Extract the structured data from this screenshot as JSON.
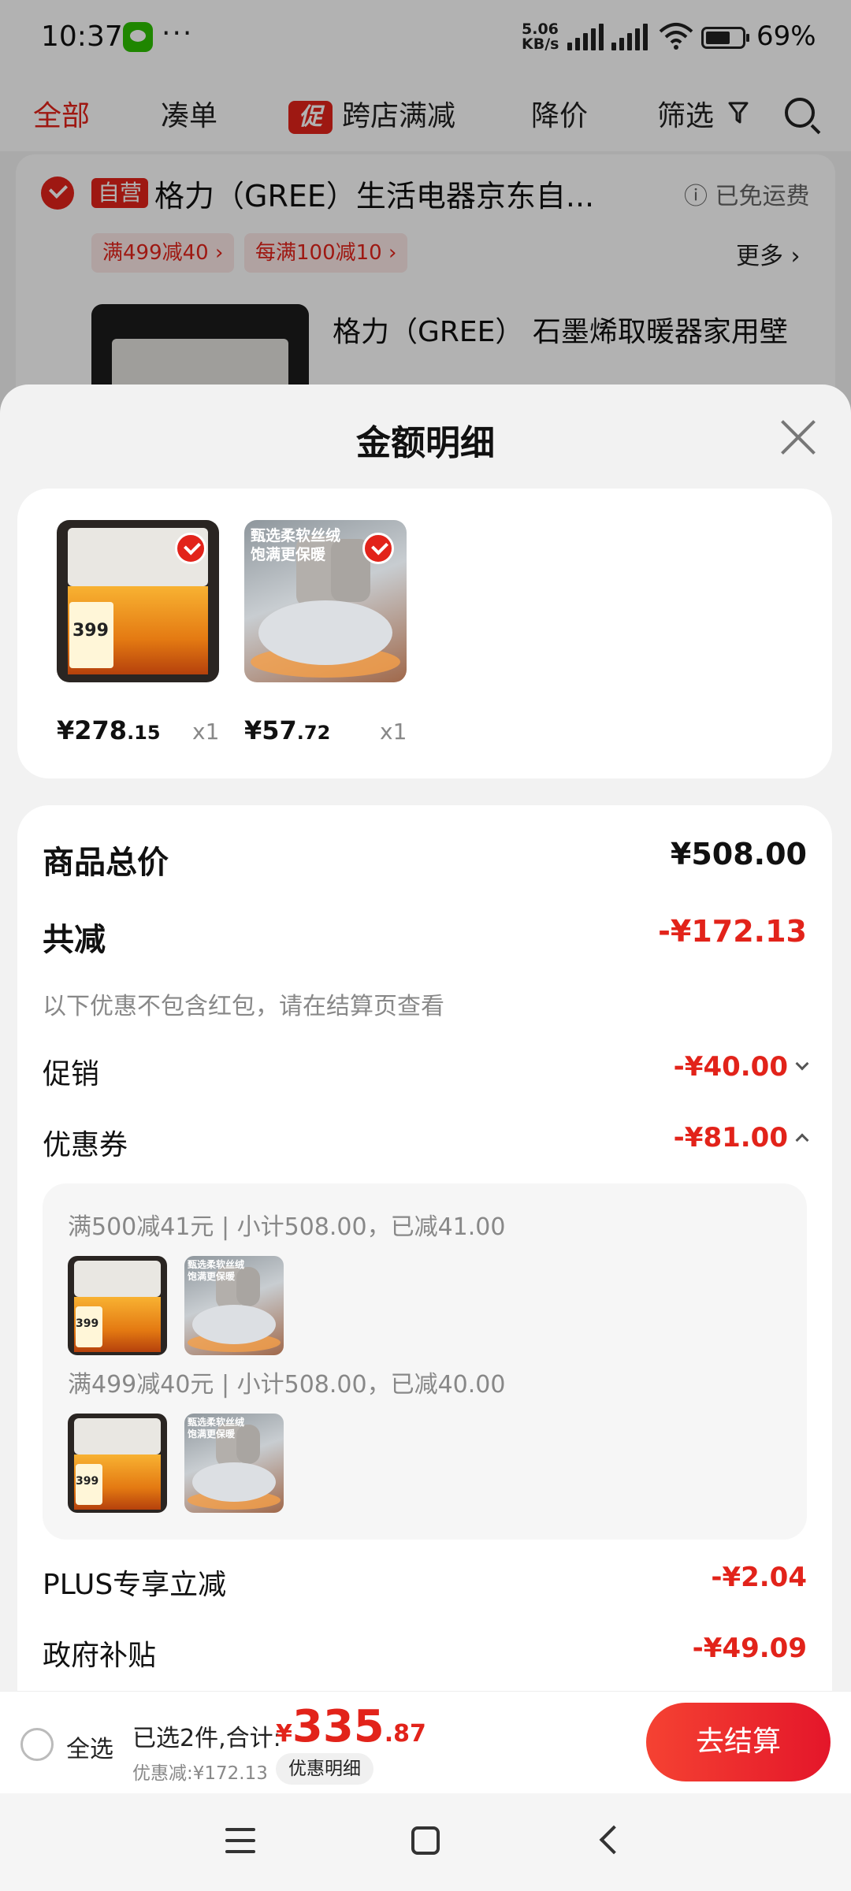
{
  "status_bar": {
    "time": "10:37",
    "dots": "···",
    "net_speed_line1": "5.06",
    "net_speed_line2": "KB/s",
    "battery": "69%"
  },
  "filter_bar": {
    "all": "全部",
    "bundle": "凑单",
    "promo_tag": "促",
    "cross_store": "跨店满减",
    "price_drop": "降价",
    "filter": "筛选"
  },
  "shop": {
    "self_tag": "自营",
    "name": "格力（GREE）生活电器京东自...",
    "free_shipping": "已免运费",
    "coupons": [
      "满499减40 ›",
      "每满100减10 ›"
    ],
    "more": "更多 ›",
    "product_title": "格力（GREE） 石墨烯取暖器家用壁"
  },
  "sheet": {
    "title": "金额明细",
    "items": [
      {
        "price_int": "¥278",
        "price_dec": ".15",
        "qty": "x1",
        "image": "heater",
        "badge": "399"
      },
      {
        "price_int": "¥57",
        "price_dec": ".72",
        "qty": "x1",
        "image": "slipper",
        "promo_text": "甄选柔软丝绒 饱满更保暖"
      }
    ],
    "goods_total_label": "商品总价",
    "goods_total_value": "¥508.00",
    "total_reduce_label": "共减",
    "total_reduce_value": "-¥172.13",
    "note": "以下优惠不包含红包，请在结算页查看",
    "promo_label": "促销",
    "promo_value": "-¥40.00",
    "coupon_label": "优惠券",
    "coupon_value": "-¥81.00",
    "coupon_rules": [
      "满500减41元 | 小计508.00，已减41.00",
      "满499减40元 | 小计508.00，已减40.00"
    ],
    "plus_label": "PLUS专享立减",
    "plus_value": "-¥2.04",
    "gov_label": "政府补贴",
    "gov_value": "-¥49.09"
  },
  "bottom_bar": {
    "select_all": "全选",
    "selected": "已选2件,合计:",
    "currency": "¥",
    "total_int": "335",
    "total_dec": ".87",
    "discount": "优惠减:¥172.13",
    "detail_button": "优惠明细",
    "checkout": "去结算"
  },
  "colors": {
    "brand_red": "#e2231a",
    "muted_text": "#888888"
  }
}
